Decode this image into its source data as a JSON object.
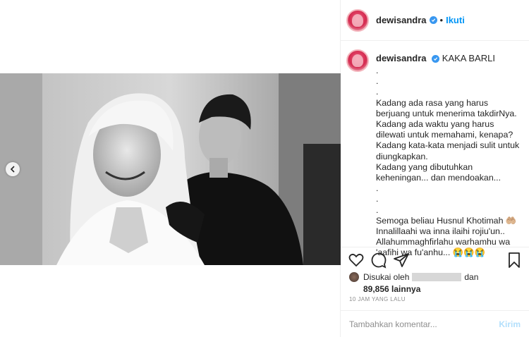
{
  "post": {
    "username": "dewisandra",
    "follow_label": "Ikuti",
    "separator": "•"
  },
  "caption": {
    "username": "dewisandra",
    "headline": "KAKA BARLI",
    "text": ".\n.\n.\nKadang ada rasa yang harus berjuang untuk menerima takdirNya. Kadang ada waktu yang harus dilewati untuk memahami, kenapa?\nKadang kata-kata menjadi sulit untuk diungkapkan.\nKadang yang dibutuhkan keheningan... dan mendoakan...\n.\n.\n.\nSemoga beliau Husnul Khotimah 🤲🏼\nInnalillaahi wa inna ilaihi rojiu'un..\nAllahummaghfirlahu warhamhu wa 'aafihi wa fu'anhu... 😭😭😭"
  },
  "likes": {
    "prefix": "Disukai oleh",
    "suffix": "dan",
    "count": "89,856 lainnya"
  },
  "timestamp": "10 JAM YANG LALU",
  "comment": {
    "placeholder": "Tambahkan komentar...",
    "post_label": "Kirim"
  },
  "icons": {
    "like": "heart-icon",
    "comment": "comment-icon",
    "share": "share-icon",
    "save": "bookmark-icon",
    "verified": "verified-badge-icon",
    "carousel_prev": "chevron-left-icon"
  },
  "colors": {
    "link": "#0095f6",
    "verified": "#3897f0",
    "post_disabled": "#b2dffc",
    "muted": "#8e8e8e",
    "border": "#efefef"
  }
}
